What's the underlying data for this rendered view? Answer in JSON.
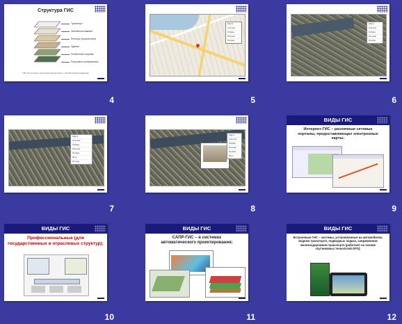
{
  "slides": [
    {
      "number": "4",
      "title": "Структура ГИС",
      "layers": [
        "Транспорт",
        "Землепользование",
        "Рельеф (горизонтали)",
        "Здания",
        "Почвенные покровы",
        "Растровое изображение"
      ],
      "caption": "ГИС интегрирует пространственную базу с атрибутивными данными"
    },
    {
      "number": "5"
    },
    {
      "number": "6"
    },
    {
      "number": "7"
    },
    {
      "number": "8"
    },
    {
      "number": "9",
      "title": "ВИДЫ ГИС",
      "body": "Интернет-ГИС – различные сетевые порталы, предоставляющих электронные карты;"
    },
    {
      "number": "10",
      "title": "ВИДЫ ГИС",
      "body": "Профессиональные (для государственных и отраслевых структур);"
    },
    {
      "number": "11",
      "title": "ВИДЫ ГИС",
      "body": "САПР-ГИС – в системах автоматического проектирования;"
    },
    {
      "number": "12",
      "title": "ВИДЫ ГИС",
      "body": "Встроенные ГИС – системы, установленные на автомобилях, водном транспорте, подводных лодках, современном железнодорожном транспорте (работают на основе спутниковых технологий GPS);"
    }
  ],
  "map_menu": [
    "Карта",
    "Спутник",
    "Гибрид",
    "Рельеф",
    "Пробки",
    "Фото",
    "Погода",
    "Метки"
  ],
  "colors": {
    "background": "#3a3aa0",
    "header": "#1a1a7a",
    "title_red": "#c00000"
  }
}
